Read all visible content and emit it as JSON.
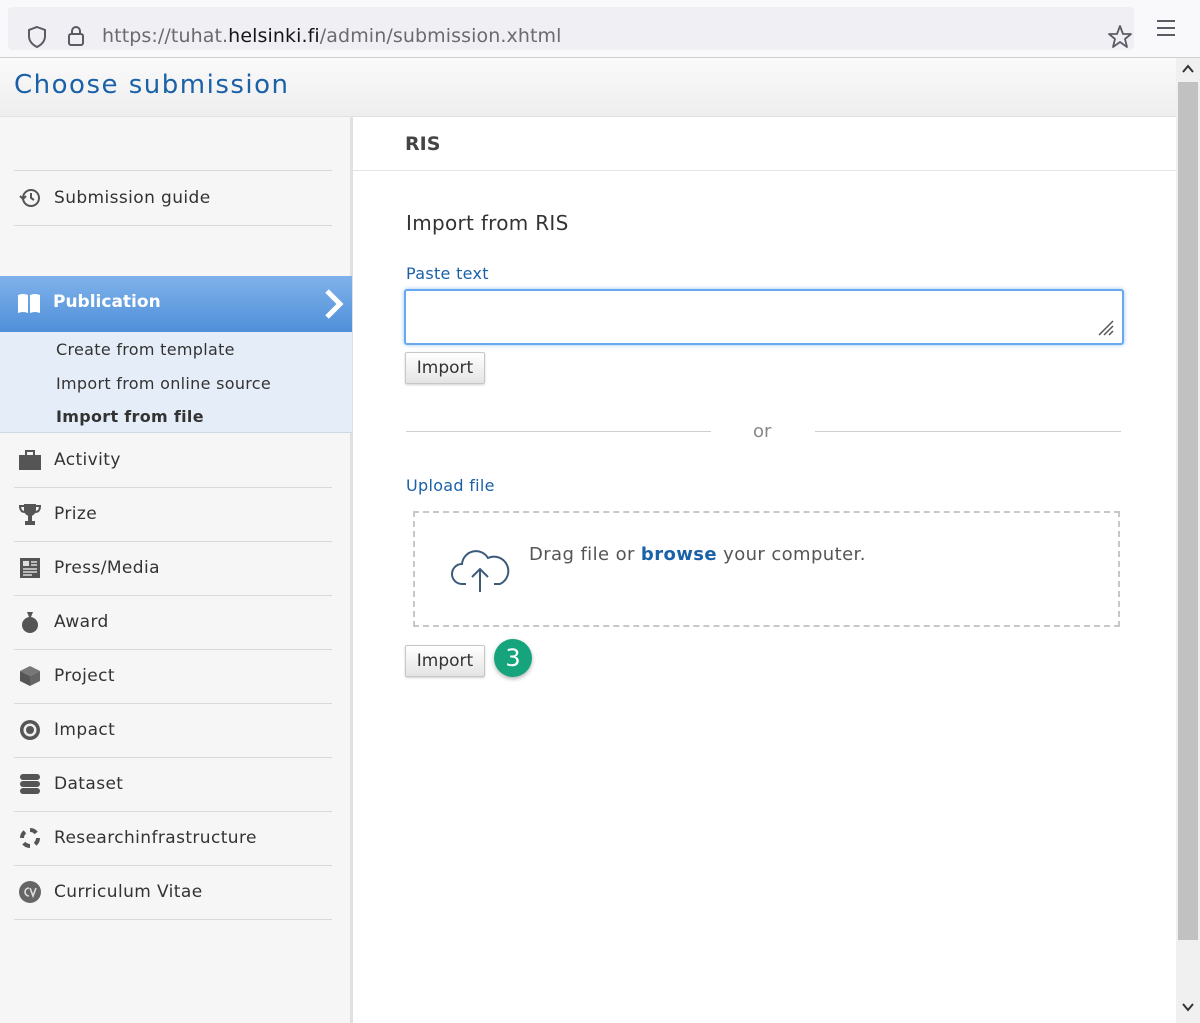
{
  "browser": {
    "url_prefix": "https://tuhat.",
    "url_domain": "helsinki.fi",
    "url_path": "/admin/submission.xhtml"
  },
  "page": {
    "title": "Choose submission"
  },
  "sidebar": {
    "guide": "Submission guide",
    "publication": {
      "label": "Publication",
      "subitems": [
        "Create from template",
        "Import from online source",
        "Import from file"
      ],
      "active_subitem": "Import from file"
    },
    "items": [
      {
        "label": "Activity",
        "icon": "briefcase-icon"
      },
      {
        "label": "Prize",
        "icon": "trophy-icon"
      },
      {
        "label": "Press/Media",
        "icon": "newspaper-icon"
      },
      {
        "label": "Award",
        "icon": "money-bag-icon"
      },
      {
        "label": "Project",
        "icon": "cube-icon"
      },
      {
        "label": "Impact",
        "icon": "target-icon"
      },
      {
        "label": "Dataset",
        "icon": "database-icon"
      },
      {
        "label": "Researchinfrastructure",
        "icon": "lifebuoy-icon"
      },
      {
        "label": "Curriculum Vitae",
        "icon": "cv-icon"
      }
    ]
  },
  "main": {
    "header": "RIS",
    "section_title": "Import from RIS",
    "paste_label": "Paste text",
    "paste_value": "",
    "import_label": "Import",
    "or_text": "or",
    "upload_label": "Upload file",
    "drop_text_before": "Drag file or",
    "drop_browse": "browse",
    "drop_text_after": "your computer.",
    "step_badge": "3"
  },
  "colors": {
    "accent": "#1a61a8",
    "publication_bg": "#5b98de",
    "badge": "#15a47c"
  }
}
